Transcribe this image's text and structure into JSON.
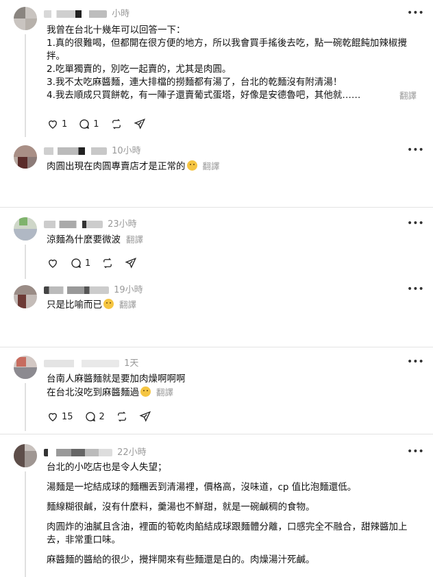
{
  "translate_label": "翻譯",
  "posts": [
    {
      "time": "小時",
      "lines": [
        "我曾在台北十幾年可以回答一下：",
        "1.真的很難喝，但都開在很方便的地方，所以我會買手搖後去吃，點一碗乾餛飩加辣椒攪拌。",
        "2.吃單獨賣的，別吃一起賣的，尤其是肉圓。",
        "3.我不太吃麻醬麵，連大排檔的撈麵都有湯了，台北的乾麵沒有附清湯！",
        "4.我去順成只買餅乾，有一陣子還賣葡式蛋塔，好像是安德魯吧，其他就……"
      ],
      "likes": "1",
      "replies": "1"
    },
    {
      "time": "10小時",
      "text": "肉圓出現在肉圓專賣店才是正常的"
    },
    {
      "time": "23小時",
      "text": "涼麵為什麼要微波",
      "replies": "1"
    },
    {
      "time": "19小時",
      "text": "只是比喻而已"
    },
    {
      "time": "1天",
      "line1": "台南人麻醬麵就是要加肉燥啊啊啊",
      "line2": "在台北沒吃到麻醬麵過",
      "likes": "15",
      "replies": "2"
    },
    {
      "time": "22小時",
      "paragraphs": [
        "台北的小吃店也是令人失望；",
        "湯麵是一坨結成球的麵糰丟到清湯裡，價格高，沒味道，cp 值比泡麵還低。",
        "麵線糊很鹹，沒有什麼料，羹湯也不鮮甜，就是一碗鹹稠的食物。",
        "肉圓炸的油膩且含油，裡面的筍乾肉餡結成球跟麵體分離，口感完全不融合，甜辣醬加上去，非常重口味。",
        "麻醬麵的醬給的很少，攪拌開來有些麵還是白的。肉燥湯汁死鹹。"
      ]
    }
  ]
}
